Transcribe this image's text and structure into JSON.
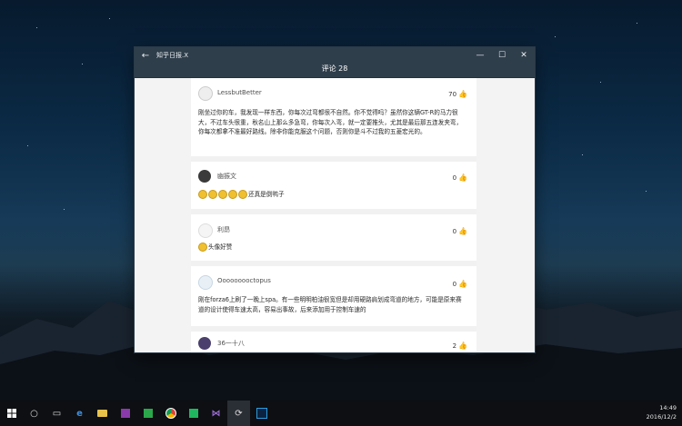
{
  "window": {
    "app_title": "知乎日报.X",
    "header": "评论 28",
    "controls": {
      "minimize": "—",
      "maximize": "☐",
      "close": "✕"
    },
    "back_icon": "arrow-left-icon"
  },
  "comments": [
    {
      "author": "LessbutBetter",
      "likes": "70",
      "text": "刚坐过你的车，我发现一样东西，你每次过弯都很不自然。你不觉得吗？虽然你这辆GT-R的马力很大，不过车头很重，秋名山上那么多急弯，你每次入弯，就一定要推头，尤其是最后那五连发夹弯，你每次都拿不准最好路线。除非你能克服这个问题，否则你是斗不过我的五菱宏光的。"
    },
    {
      "author": "幽振文",
      "likes": "0",
      "text": "还真是倒鸭子"
    },
    {
      "author": "利昂",
      "likes": "0",
      "text": "头像好赞"
    },
    {
      "author": "Ooooooooctopus",
      "likes": "0",
      "text": "刚在forza6上刷了一晚上spa。有一些明明柏油很宽但是却用硬路肩划成弯道的地方，可能是原来赛道的设计使得车速太高，容易出事故，后来添加用于控制车速的"
    },
    {
      "author": "36一十八",
      "likes": "2",
      "text": ""
    }
  ],
  "taskbar": {
    "time": "14:49",
    "date": "2016/12/2"
  }
}
